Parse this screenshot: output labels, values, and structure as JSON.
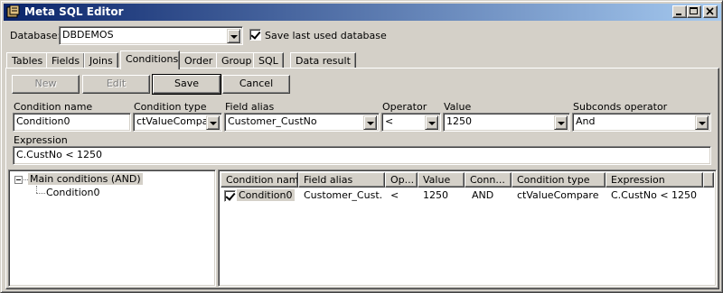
{
  "window": {
    "title": "Meta SQL Editor"
  },
  "database": {
    "label": "Database:",
    "value": "DBDEMOS",
    "save_last_label": "Save last used database",
    "save_last_checked": true
  },
  "tabs": [
    "Tables",
    "Fields",
    "Joins",
    "Conditions",
    "Order",
    "Group",
    "SQL",
    "Data result"
  ],
  "active_tab": "Conditions",
  "actions": {
    "new": "New",
    "edit": "Edit",
    "save": "Save",
    "cancel": "Cancel"
  },
  "form": {
    "condition_name": {
      "label": "Condition name",
      "value": "Condition0"
    },
    "condition_type": {
      "label": "Condition type",
      "value": "ctValueCompare"
    },
    "field_alias": {
      "label": "Field alias",
      "value": "Customer_CustNo"
    },
    "operator": {
      "label": "Operator",
      "value": "<"
    },
    "value": {
      "label": "Value",
      "value": "1250"
    },
    "subconds_operator": {
      "label": "Subconds operator",
      "value": "And"
    },
    "expression": {
      "label": "Expression",
      "value": "C.CustNo < 1250"
    }
  },
  "tree": {
    "root": "Main conditions (AND)",
    "children": [
      "Condition0"
    ]
  },
  "grid": {
    "columns": [
      "Condition name",
      "Field alias",
      "Op...",
      "Value",
      "Conn...",
      "Condition type",
      "Expression"
    ],
    "rows": [
      {
        "checked": true,
        "condition_name": "Condition0",
        "field_alias": "Customer_Cust...",
        "operator": "<",
        "value": "1250",
        "connector": "AND",
        "condition_type": "ctValueCompare",
        "expression": "C.CustNo < 1250"
      }
    ]
  }
}
